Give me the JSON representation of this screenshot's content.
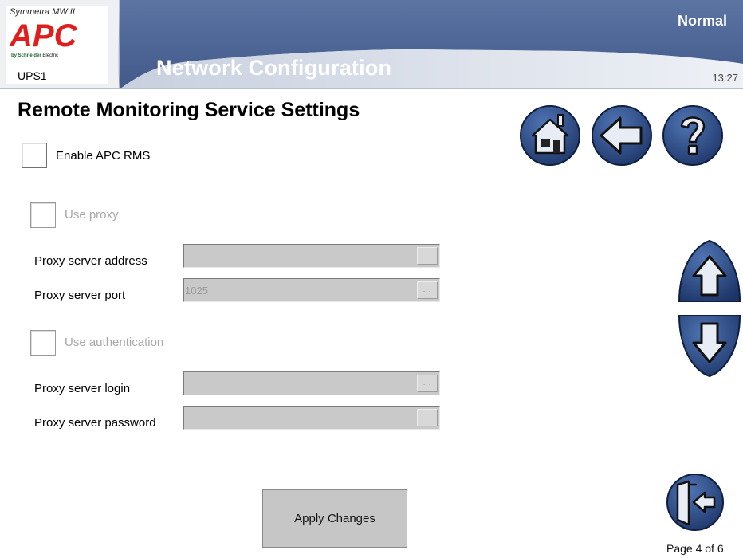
{
  "header": {
    "product_name": "Symmetra MW II",
    "brand": "APC",
    "brand_subtitle_bold": "by Schneider",
    "brand_subtitle_rest": "Electric",
    "device_name": "UPS1",
    "screen_title": "Network Configuration",
    "status": "Normal",
    "time": "13:27"
  },
  "page": {
    "title": "Remote Monitoring Service Settings",
    "indicator": "Page 4 of 6"
  },
  "form": {
    "enable_rms": {
      "label": "Enable APC RMS",
      "checked": false
    },
    "use_proxy": {
      "label": "Use proxy",
      "checked": false,
      "enabled": false
    },
    "proxy_address": {
      "label": "Proxy server address",
      "value": ""
    },
    "proxy_port": {
      "label": "Proxy server port",
      "value": "1025"
    },
    "use_auth": {
      "label": "Use authentication",
      "checked": false,
      "enabled": false
    },
    "proxy_login": {
      "label": "Proxy server login",
      "value": ""
    },
    "proxy_password": {
      "label": "Proxy server password",
      "value": ""
    },
    "browse_glyph": "...",
    "apply_label": "Apply Changes"
  },
  "nav_icons": [
    "home-icon",
    "back-arrow-icon",
    "help-icon",
    "scroll-up-icon",
    "scroll-down-icon",
    "logout-icon"
  ],
  "colors": {
    "header_blue": "#4c6796",
    "button_blue": "#2a4a82",
    "disabled_text": "#a8a8a8",
    "field_gray": "#c9c9c9"
  }
}
